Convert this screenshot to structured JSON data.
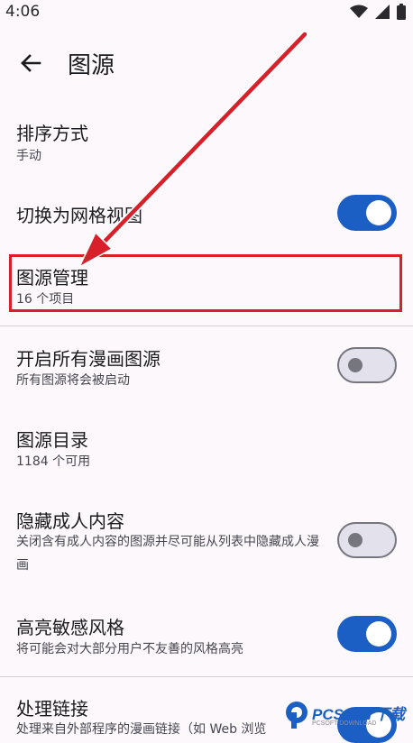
{
  "status_bar": {
    "time": "4:06"
  },
  "app_bar": {
    "title": "图源"
  },
  "settings": {
    "sort": {
      "title": "排序方式",
      "subtitle": "手动"
    },
    "grid_view": {
      "title": "切换为网格视图",
      "enabled": true
    },
    "source_management": {
      "title": "图源管理",
      "subtitle": "16 个项目"
    },
    "enable_all": {
      "title": "开启所有漫画图源",
      "subtitle": "所有图源将会被启动",
      "enabled": false
    },
    "catalog": {
      "title": "图源目录",
      "subtitle": "1184 个可用"
    },
    "hide_adult": {
      "title": "隐藏成人内容",
      "subtitle": "关闭含有成人内容的图源并尽可能从列表中隐藏成人漫画",
      "enabled": false
    },
    "highlight_sensitive": {
      "title": "高亮敏感风格",
      "subtitle": "将可能会对大部分用户不友善的风格高亮",
      "enabled": true
    },
    "handle_links": {
      "title": "处理链接",
      "subtitle": "处理来自外部程序的漫画链接（如 Web 浏览",
      "enabled": true
    }
  },
  "watermark": {
    "brand": "PCSOFT下载",
    "sub": "PCSOFT DOWNLOAD"
  },
  "colors": {
    "accent": "#1c5fc4",
    "annotation": "#d8202b",
    "background": "#fdf8fc"
  }
}
